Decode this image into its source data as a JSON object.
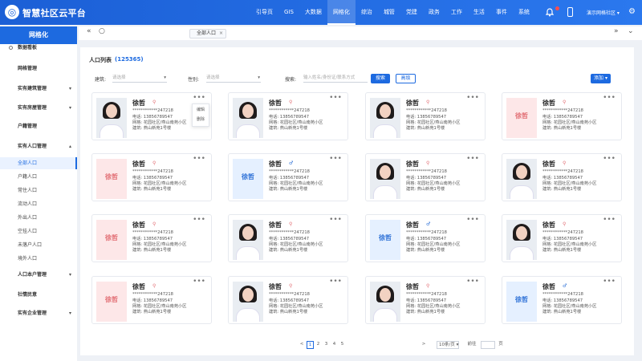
{
  "app": {
    "logo": "◎",
    "title": "智慧社区云平台"
  },
  "nav": [
    "引导页",
    "GIS",
    "大数据",
    "网格化",
    "综治",
    "城管",
    "党建",
    "政务",
    "工作",
    "生活",
    "事件",
    "系统"
  ],
  "nav_active_index": 3,
  "header": {
    "user": "演示网格社区 ▾",
    "gear": "⚙"
  },
  "sidebar": {
    "title": "网格化",
    "items": [
      {
        "label": "数据看板",
        "type": "top",
        "icon": "dashboard-icon"
      },
      {
        "label": "网格管理",
        "type": "top"
      },
      {
        "label": "实有建筑管理",
        "type": "group",
        "arrow": "▾"
      },
      {
        "label": "实有房屋管理",
        "type": "group",
        "arrow": "▾"
      },
      {
        "label": "户籍管理",
        "type": "top"
      },
      {
        "label": "实有人口管理",
        "type": "group",
        "arrow": "▴"
      },
      {
        "label": "全部人口",
        "type": "sub",
        "active": true
      },
      {
        "label": "户籍人口",
        "type": "sub"
      },
      {
        "label": "常住人口",
        "type": "sub"
      },
      {
        "label": "流动人口",
        "type": "sub"
      },
      {
        "label": "外出人口",
        "type": "sub"
      },
      {
        "label": "空挂人口",
        "type": "sub"
      },
      {
        "label": "未落户人口",
        "type": "sub"
      },
      {
        "label": "境外人口",
        "type": "sub"
      },
      {
        "label": "人口本户管理",
        "type": "group",
        "arrow": "▾"
      },
      {
        "label": "社情民意",
        "type": "top"
      },
      {
        "label": "实有企业管理",
        "type": "group",
        "arrow": "▾"
      }
    ]
  },
  "tabs": {
    "back": "«",
    "refresh": "○",
    "forward": "»",
    "more": "⌄",
    "current": "全部人口",
    "close": "×"
  },
  "list": {
    "title": "人口列表",
    "count": "(125365)",
    "filters": {
      "building_label": "建筑:",
      "building_placeholder": "请选择",
      "gender_label": "性别:",
      "gender_placeholder": "请选择",
      "search_label": "搜索:",
      "search_placeholder": "输入姓名/身份证/联系方式",
      "search_button": "搜索",
      "advanced_button": "高级",
      "action_button": "添加 ▾"
    }
  },
  "labels": {
    "phone": "电话:",
    "grid": "网格:",
    "building": "建筑:",
    "more": "•••",
    "placeholder": "徐哲"
  },
  "cards": [
    {
      "name": "徐哲",
      "gender": "female",
      "avatar": "photo",
      "id": "************247218",
      "phone": "13856789547",
      "grid": "花园社区/燕山南苑小区",
      "building": "燕山新苑1号楼",
      "menu": true
    },
    {
      "name": "徐哲",
      "gender": "female",
      "avatar": "photo",
      "id": "************247218",
      "phone": "13856789547",
      "grid": "花园社区/燕山南苑小区",
      "building": "燕山新苑1号楼"
    },
    {
      "name": "徐哲",
      "gender": "female",
      "avatar": "photo",
      "id": "************247218",
      "phone": "13856789547",
      "grid": "花园社区/燕山南苑小区",
      "building": "燕山新苑1号楼"
    },
    {
      "name": "徐哲",
      "gender": "female",
      "avatar": "pink",
      "id": "************247218",
      "phone": "13856789547",
      "grid": "花园社区/燕山南苑小区",
      "building": "燕山新苑1号楼"
    },
    {
      "name": "徐哲",
      "gender": "female",
      "avatar": "pink",
      "id": "************247218",
      "phone": "13856789547",
      "grid": "花园社区/燕山南苑小区",
      "building": "燕山新苑1号楼"
    },
    {
      "name": "徐哲",
      "gender": "male",
      "avatar": "blue",
      "id": "************247218",
      "phone": "13856789547",
      "grid": "花园社区/燕山南苑小区",
      "building": "燕山新苑1号楼"
    },
    {
      "name": "徐哲",
      "gender": "female",
      "avatar": "photo",
      "id": "************247218",
      "phone": "13856789547",
      "grid": "花园社区/燕山南苑小区",
      "building": "燕山新苑1号楼"
    },
    {
      "name": "徐哲",
      "gender": "female",
      "avatar": "photo",
      "id": "************247218",
      "phone": "13856789547",
      "grid": "花园社区/燕山南苑小区",
      "building": "燕山新苑1号楼"
    },
    {
      "name": "徐哲",
      "gender": "female",
      "avatar": "pink",
      "id": "************247218",
      "phone": "13856789547",
      "grid": "花园社区/燕山南苑小区",
      "building": "燕山新苑1号楼"
    },
    {
      "name": "徐哲",
      "gender": "female",
      "avatar": "photo",
      "id": "************247218",
      "phone": "13856789547",
      "grid": "花园社区/燕山南苑小区",
      "building": "燕山新苑1号楼"
    },
    {
      "name": "徐哲",
      "gender": "male",
      "avatar": "blue",
      "id": "************247218",
      "phone": "13856789547",
      "grid": "花园社区/燕山南苑小区",
      "building": "燕山新苑1号楼"
    },
    {
      "name": "徐哲",
      "gender": "female",
      "avatar": "photo",
      "id": "************247218",
      "phone": "13856789547",
      "grid": "花园社区/燕山南苑小区",
      "building": "燕山新苑1号楼"
    },
    {
      "name": "徐哲",
      "gender": "female",
      "avatar": "pink",
      "id": "************247218",
      "phone": "13856789547",
      "grid": "花园社区/燕山南苑小区",
      "building": "燕山新苑1号楼"
    },
    {
      "name": "徐哲",
      "gender": "female",
      "avatar": "photo",
      "id": "************247218",
      "phone": "13856789547",
      "grid": "花园社区/燕山南苑小区",
      "building": "燕山新苑1号楼"
    },
    {
      "name": "徐哲",
      "gender": "female",
      "avatar": "photo",
      "id": "************247218",
      "phone": "13856789547",
      "grid": "花园社区/燕山南苑小区",
      "building": "燕山新苑1号楼"
    },
    {
      "name": "徐哲",
      "gender": "male",
      "avatar": "blue",
      "id": "************247218",
      "phone": "13856789547",
      "grid": "花园社区/燕山南苑小区",
      "building": "燕山新苑1号楼"
    }
  ],
  "card_menu": [
    "编辑",
    "删除"
  ],
  "pagination": {
    "prev": "<",
    "pages": [
      "1",
      "2",
      "3",
      "4",
      "5"
    ],
    "current_page": 1,
    "next": ">",
    "page_size": "10条/页 ▾",
    "goto_label": "前往",
    "goto_suffix": "页"
  },
  "colors": {
    "primary": "#1d6ae0",
    "placeholder_red": "#e26d73",
    "placeholder_blue": "#2b6fd6"
  }
}
